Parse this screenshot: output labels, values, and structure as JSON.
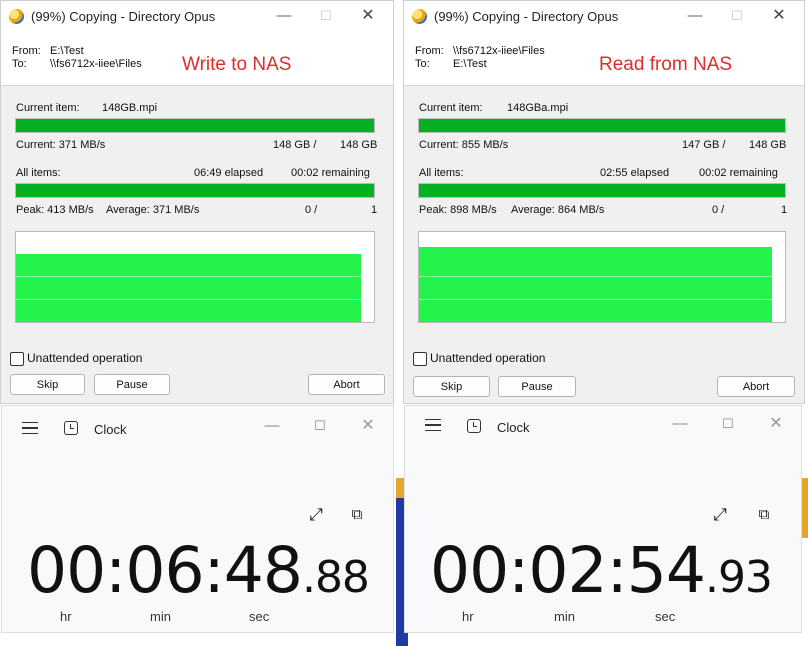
{
  "opus_left": {
    "title": "(99%) Copying - Directory Opus",
    "from_label": "From:",
    "from_value": "E:\\Test",
    "to_label": "To:",
    "to_value": "\\\\fs6712x-iiee\\Files",
    "direction": "Write to NAS",
    "current_item_label": "Current item:",
    "current_item_value": "148GB.mpi",
    "current_progress": 1.0,
    "current_speed": "Current: 371 MB/s",
    "current_done": "148 GB /",
    "current_total": "148 GB",
    "all_items_label": "All items:",
    "elapsed": "06:49 elapsed",
    "remaining": "00:02 remaining",
    "all_progress": 1.0,
    "peak": "Peak: 413 MB/s",
    "average": "Average: 371 MB/s",
    "files_done": "0 /",
    "files_total": "1",
    "unattended": "Unattended operation",
    "skip": "Skip",
    "pause": "Pause",
    "abort": "Abort"
  },
  "opus_right": {
    "title": "(99%) Copying - Directory Opus",
    "from_label": "From:",
    "from_value": "\\\\fs6712x-iiee\\Files",
    "to_label": "To:",
    "to_value": "E:\\Test",
    "direction": "Read from NAS",
    "current_item_label": "Current item:",
    "current_item_value": "148GBa.mpi",
    "current_progress": 1.0,
    "current_speed": "Current: 855 MB/s",
    "current_done": "147 GB /",
    "current_total": "148 GB",
    "all_items_label": "All items:",
    "elapsed": "02:55 elapsed",
    "remaining": "00:02 remaining",
    "all_progress": 1.0,
    "peak": "Peak: 898 MB/s",
    "average": "Average: 864 MB/s",
    "files_done": "0 /",
    "files_total": "1",
    "unattended": "Unattended operation",
    "skip": "Skip",
    "pause": "Pause",
    "abort": "Abort"
  },
  "clock_left": {
    "title": "Clock",
    "time_main": "00:06:48",
    "time_frac": ".88",
    "hr": "hr",
    "min": "min",
    "sec": "sec"
  },
  "clock_right": {
    "title": "Clock",
    "time_main": "00:02:54",
    "time_frac": ".93",
    "hr": "hr",
    "min": "min",
    "sec": "sec"
  },
  "colors": {
    "progress": "#06b025",
    "graph": "#23f34a",
    "direction_label": "#e02b2b"
  },
  "icons": {
    "app": "directory-opus-icon",
    "minimize": "minimize-icon",
    "maximize": "maximize-icon",
    "close": "close-icon",
    "menu": "hamburger-menu-icon",
    "clock": "clock-app-icon",
    "expand": "expand-icon",
    "compact": "compact-overlay-icon"
  }
}
